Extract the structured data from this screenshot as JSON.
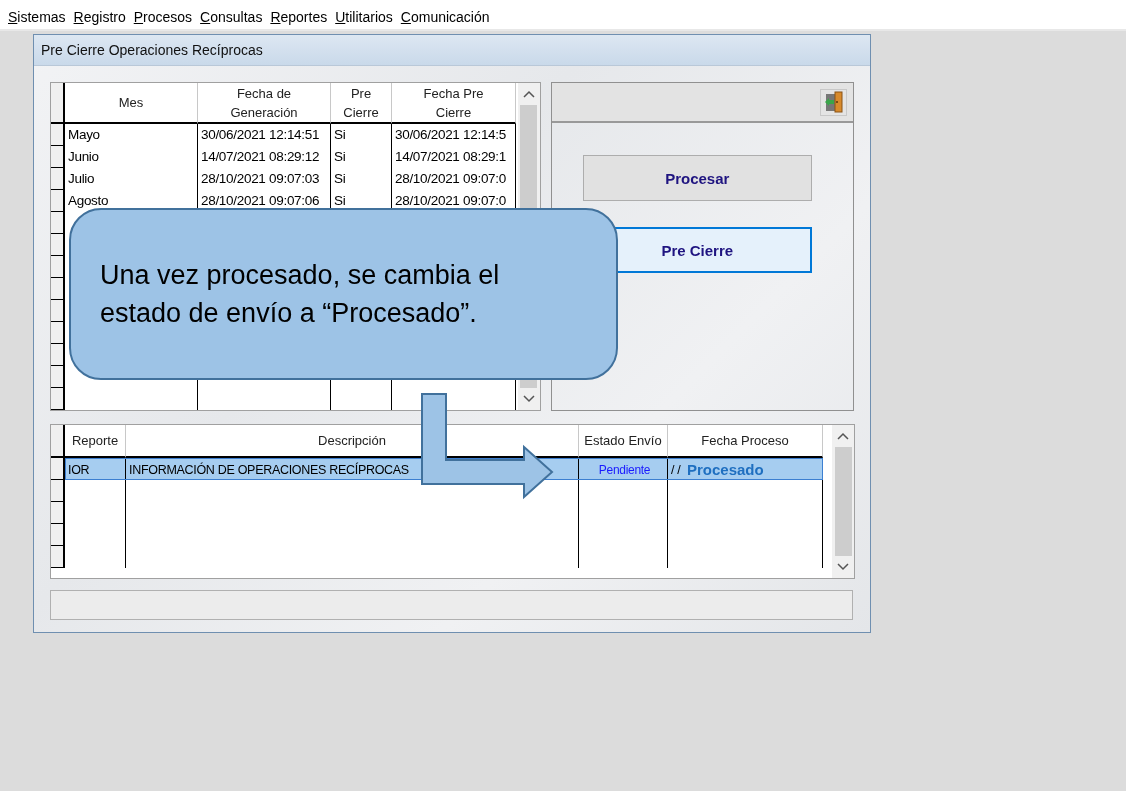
{
  "menu_bar": {
    "items": [
      "Sistemas",
      "Registro",
      "Procesos",
      "Consultas",
      "Reportes",
      "Utilitarios",
      "Comunicación"
    ]
  },
  "window": {
    "title": "Pre Cierre Operaciones Recíprocas"
  },
  "periods_table": {
    "columns": [
      "Mes",
      "Fecha de\nGeneración",
      "Pre\nCierre",
      "Fecha  Pre\nCierre"
    ],
    "rows": [
      {
        "cells": [
          "Mayo",
          "30/06/2021 12:14:51",
          "Si",
          "30/06/2021 12:14:5"
        ]
      },
      {
        "cells": [
          "Junio",
          "14/07/2021 08:29:12",
          "Si",
          "14/07/2021 08:29:1"
        ]
      },
      {
        "cells": [
          "Julio",
          "28/10/2021 09:07:03",
          "Si",
          "28/10/2021 09:07:0"
        ]
      },
      {
        "cells": [
          "Agosto",
          "28/10/2021 09:07:06",
          "Si",
          "28/10/2021 09:07:0"
        ]
      }
    ]
  },
  "actions": [
    {
      "label": "Procesar",
      "focused": false
    },
    {
      "label": "Pre Cierre",
      "focused": true
    }
  ],
  "reports_table": {
    "columns": [
      "Reporte",
      "Descripción",
      "Estado Envío",
      "Fecha Proceso"
    ],
    "rows": [
      {
        "cells": [
          "IOR",
          "INFORMACIÓN DE OPERACIONES RECÍPROCAS",
          "Pendiente",
          "/  /"
        ],
        "selected": true
      }
    ]
  },
  "callout": {
    "text": "Una vez procesado, se cambia el estado de envío a “Procesado”."
  },
  "annotation": {
    "label": "Procesado"
  }
}
